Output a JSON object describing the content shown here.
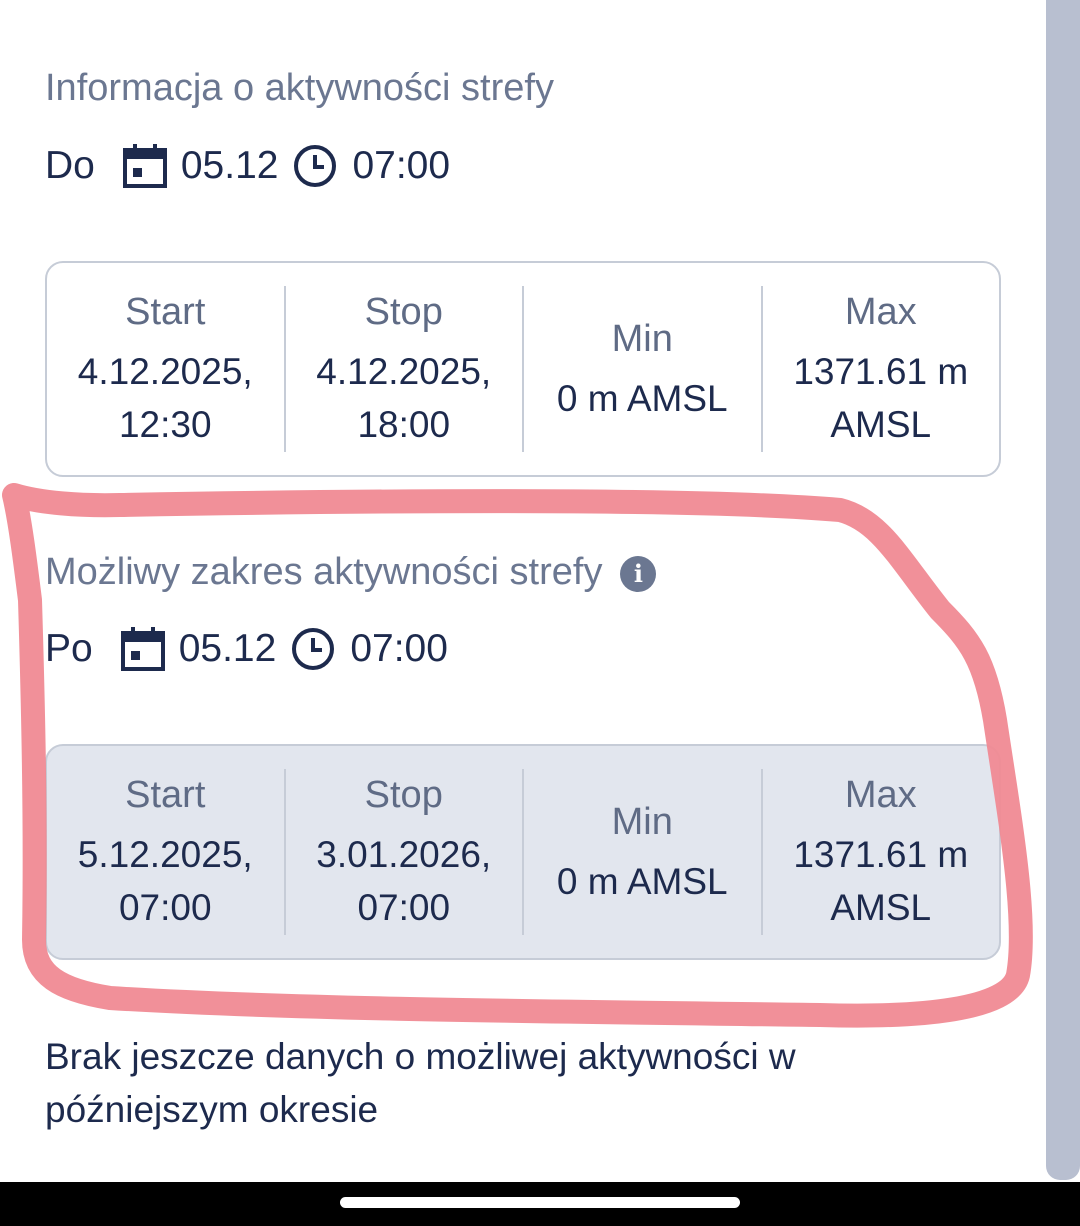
{
  "current": {
    "title": "Informacja o aktywności strefy",
    "prefix": "Do",
    "date": "05.12",
    "time": "07:00",
    "table": [
      {
        "label": "Start",
        "value": "4.12.2025, 12:30"
      },
      {
        "label": "Stop",
        "value": "4.12.2025, 18:00"
      },
      {
        "label": "Min",
        "value": "0 m AMSL"
      },
      {
        "label": "Max",
        "value": "1371.61 m AMSL"
      }
    ]
  },
  "possible": {
    "title": "Możliwy zakres aktywności strefy",
    "prefix": "Po",
    "date": "05.12",
    "time": "07:00",
    "table": [
      {
        "label": "Start",
        "value": "5.12.2025, 07:00"
      },
      {
        "label": "Stop",
        "value": "3.01.2026, 07:00"
      },
      {
        "label": "Min",
        "value": "0 m AMSL"
      },
      {
        "label": "Max",
        "value": "1371.61 m AMSL"
      }
    ]
  },
  "note": "Brak jeszcze danych o możliwej aktywności w późniejszym okresie",
  "icons": {
    "calendar": "calendar-icon",
    "clock": "clock-icon",
    "info": "info-icon"
  },
  "colors": {
    "text_primary": "#1d2a4d",
    "text_muted": "#6b7791",
    "border": "#c6ccd7",
    "shaded_bg": "#e2e6ee",
    "annotation": "#f08a94"
  }
}
